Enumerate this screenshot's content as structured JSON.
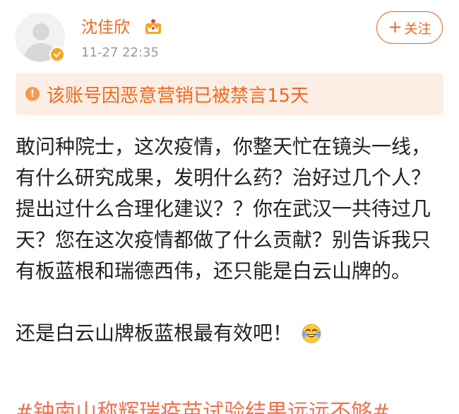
{
  "post": {
    "username": "沈佳欣",
    "timestamp": "11-27 22:35",
    "follow_label": "关注",
    "notice": "该账号因恶意营销已被禁言15天",
    "paragraphs": [
      "敢问种院士，这次疫情，你整天忙在镜头一线，有什么研究成果，发明什么药？治好过几个人？提出过什么合理化建议？？你在武汉一共待过几天？您在这次疫情都做了什么贡献？别告诉我只有板蓝根和瑞德西伟，还只能是白云山牌的。",
      "还是白云山牌板蓝根最有效吧！"
    ],
    "hashtag": "#钟南山称辉瑞疫苗试验结果远远不够#"
  },
  "colors": {
    "accent": "#ec6a1c",
    "notice_bg": "#fdeee5",
    "text": "#222222",
    "meta": "#999999"
  },
  "icons": {
    "verified": "verified-badge-icon",
    "member": "crown-icon",
    "warning": "warning-icon",
    "emoji": "laugh-cry-emoji-icon"
  }
}
